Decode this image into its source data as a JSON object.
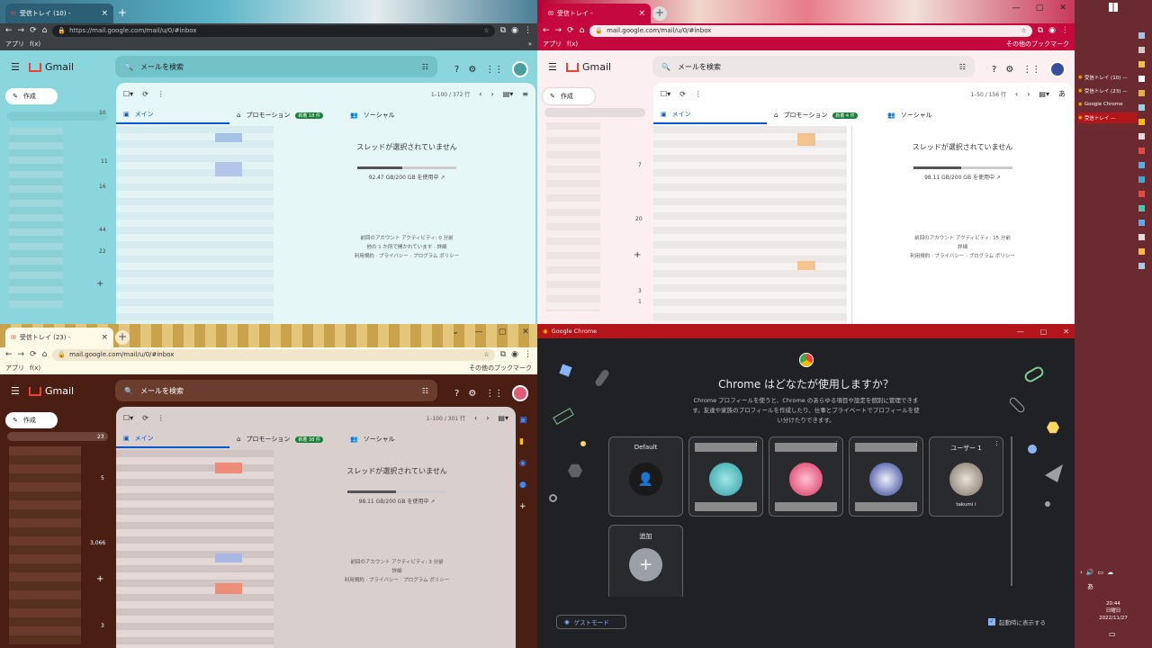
{
  "windows": {
    "top_left": {
      "tab_title": "受信トレイ (10) -",
      "url": "https://mail.google.com/mail/u/0/#inbox",
      "bookmarks": {
        "apps": "アプリ",
        "fx": "f(x)"
      },
      "search_placeholder": "メールを検索",
      "app_name": "Gmail",
      "compose": "作成",
      "pager": "1–100 / 372 行",
      "tabs": {
        "main": "メイン",
        "promo": "プロモーション",
        "promo_badge": "新着 18 件",
        "social": "ソーシャル"
      },
      "no_thread": "スレッドが選択されていません",
      "storage": "92.47 GB/200 GB を使用中",
      "footer": [
        "前回のアカウント アクティビティ: 0 分前",
        "他の 1 か所で開かれています · 詳細",
        "利用規約 · プライバシー · プログラム ポリシー"
      ],
      "side_counts": [
        "10",
        "11",
        "16",
        "44",
        "22"
      ],
      "accent": "#8ad6dc"
    },
    "top_right": {
      "tab_title": "受信トレイ -",
      "url": "mail.google.com/mail/u/0/#inbox",
      "bookmarks": {
        "apps": "アプリ",
        "fx": "f(x)",
        "other": "その他のブックマーク"
      },
      "search_placeholder": "メールを検索",
      "app_name": "Gmail",
      "compose": "作成",
      "pager": "1–50 / 156 行",
      "tabs": {
        "main": "メイン",
        "promo": "プロモーション",
        "promo_badge": "新着 4 件",
        "social": "ソーシャル"
      },
      "no_thread": "スレッドが選択されていません",
      "storage": "98.11 GB/200 GB を使用中",
      "footer": [
        "前回のアカウント アクティビティ: 15 分前",
        "詳細",
        "利用規約 · プライバシー · プログラム ポリシー"
      ],
      "side_counts": [
        "7",
        "20",
        "3",
        "1"
      ],
      "lang": "あ",
      "accent": "#c5083d"
    },
    "bottom_left": {
      "tab_title": "受信トレイ (23) -",
      "url": "mail.google.com/mail/u/0/#inbox",
      "bookmarks": {
        "apps": "アプリ",
        "fx": "f(x)",
        "other": "その他のブックマーク"
      },
      "search_placeholder": "メールを検索",
      "app_name": "Gmail",
      "compose": "作成",
      "pager": "1–100 / 301 行",
      "tabs": {
        "main": "メイン",
        "promo": "プロモーション",
        "promo_badge": "新着 38 件",
        "social": "ソーシャル"
      },
      "no_thread": "スレッドが選択されていません",
      "storage": "98.11 GB/200 GB を使用中",
      "footer": [
        "前回のアカウント アクティビティ: 3 分前",
        "詳細",
        "利用規約 · プライバシー · プログラム ポリシー"
      ],
      "side_counts": [
        "23",
        "5",
        "3,066",
        "3"
      ],
      "accent": "#4a1e12"
    },
    "picker": {
      "title_bar": "Google Chrome",
      "heading": "Chrome はどなたが使用しますか？",
      "description": "Chrome プロフィールを使うと、Chrome のあらゆる項目や設定を個別に管理できます。友達や家族のプロフィールを作成したり、仕事とプライベートでプロフィールを使い分けたりできます。",
      "profiles": [
        {
          "name": "Default",
          "sub": ""
        },
        {
          "name": "",
          "sub": ""
        },
        {
          "name": "",
          "sub": ""
        },
        {
          "name": "",
          "sub": ""
        },
        {
          "name": "ユーザー 1",
          "sub": "takumi i"
        }
      ],
      "add_label": "追加",
      "guest_button": "ゲストモード",
      "startup_checkbox": "起動時に表示する"
    }
  },
  "taskbar": {
    "items": [
      "受信トレイ (10) —",
      "受信トレイ (23) —",
      "Google Chrome",
      "受信トレイ —"
    ],
    "time": "20:44",
    "day": "日曜日",
    "date": "2022/11/27"
  }
}
